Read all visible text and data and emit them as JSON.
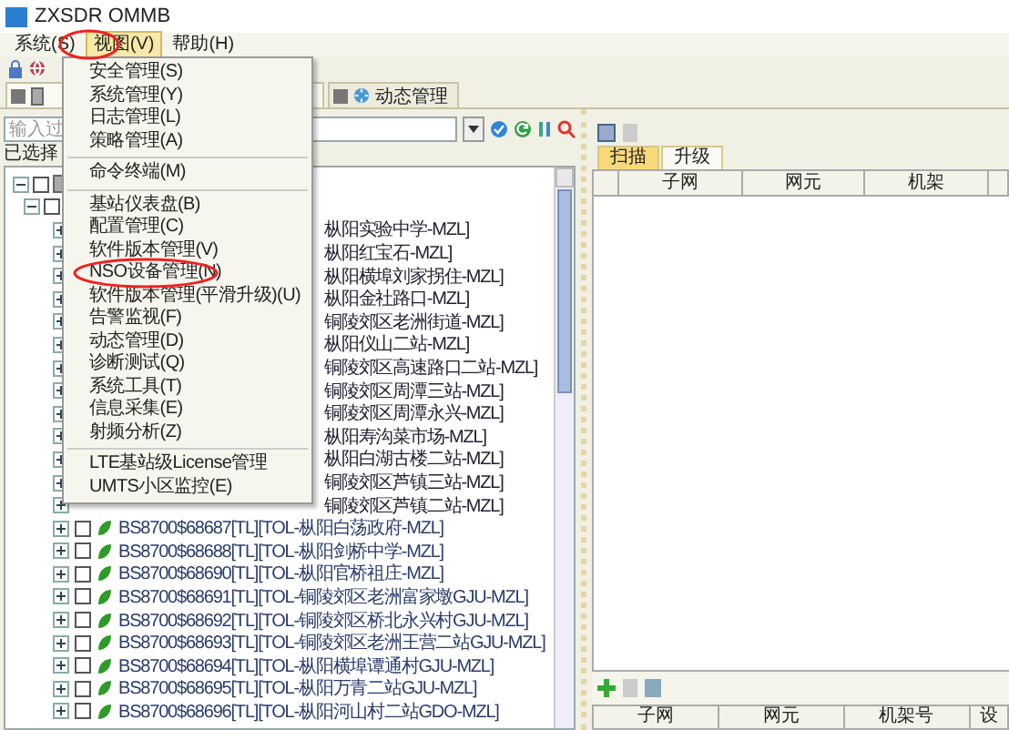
{
  "window": {
    "title": "ZXSDR OMMB"
  },
  "menubar": [
    {
      "label": "系统(S)",
      "selected": false
    },
    {
      "label": "视图(V)",
      "selected": true
    },
    {
      "label": "帮助(H)",
      "selected": false
    }
  ],
  "menu": {
    "items": [
      {
        "kind": "item",
        "label": "安全管理(S)"
      },
      {
        "kind": "item",
        "label": "系统管理(Y)"
      },
      {
        "kind": "item",
        "label": "日志管理(L)"
      },
      {
        "kind": "item",
        "label": "策略管理(A)"
      },
      {
        "kind": "separator"
      },
      {
        "kind": "item",
        "label": "命令终端(M)"
      },
      {
        "kind": "separator"
      },
      {
        "kind": "item",
        "label": "基站仪表盘(B)"
      },
      {
        "kind": "item",
        "label": "配置管理(C)"
      },
      {
        "kind": "item",
        "label": "软件版本管理(V)"
      },
      {
        "kind": "item",
        "label": "NSO设备管理(N)",
        "circled": true
      },
      {
        "kind": "item",
        "label": "软件版本管理(平滑升级)(U)"
      },
      {
        "kind": "item",
        "label": "告警监视(F)"
      },
      {
        "kind": "item",
        "label": "动态管理(D)"
      },
      {
        "kind": "item",
        "label": "诊断测试(Q)"
      },
      {
        "kind": "item",
        "label": "系统工具(T)"
      },
      {
        "kind": "item",
        "label": "信息采集(E)"
      },
      {
        "kind": "item",
        "label": "射频分析(Z)"
      },
      {
        "kind": "separator"
      },
      {
        "kind": "item",
        "label": "LTE基站级License管理"
      },
      {
        "kind": "item",
        "label": "UMTS小区监控(E)"
      }
    ]
  },
  "tabs": [
    {
      "selected": true
    },
    {
      "label": "动态管理",
      "selected": false
    }
  ],
  "left_panel": {
    "filter": {
      "placeholder": "输入过"
    },
    "selection_label": "已选择",
    "tree": [
      {
        "expanded": true,
        "checked": false,
        "children": [
          {
            "expanded": true,
            "checked": false,
            "children": [
              {
                "kind": "covered",
                "label": "枞阳实验中学-MZL]"
              },
              {
                "kind": "covered",
                "label": "枞阳红宝石-MZL]"
              },
              {
                "kind": "covered",
                "label": "枞阳横埠刘家拐住-MZL]"
              },
              {
                "kind": "covered",
                "label": "枞阳金社路口-MZL]"
              },
              {
                "kind": "covered",
                "label": "铜陵郊区老洲街道-MZL]"
              },
              {
                "kind": "covered",
                "label": "枞阳仪山二站-MZL]"
              },
              {
                "kind": "covered",
                "label": "铜陵郊区高速路口二站-MZL]"
              },
              {
                "kind": "covered",
                "label": "铜陵郊区周潭三站-MZL]"
              },
              {
                "kind": "covered",
                "label": "铜陵郊区周潭永兴-MZL]"
              },
              {
                "kind": "covered",
                "label": "枞阳寿沟菜市场-MZL]"
              },
              {
                "kind": "covered",
                "label": "枞阳白湖古楼二站-MZL]"
              },
              {
                "kind": "covered",
                "label": "铜陵郊区芦镇三站-MZL]"
              },
              {
                "kind": "covered",
                "label": "铜陵郊区芦镇二站-MZL]"
              },
              {
                "kind": "full",
                "checked": false,
                "label": "BS8700$68687[TL][TOL-枞阳白荡政府-MZL]"
              },
              {
                "kind": "full",
                "checked": false,
                "label": "BS8700$68688[TL][TOL-枞阳剑桥中学-MZL]"
              },
              {
                "kind": "full",
                "checked": false,
                "label": "BS8700$68690[TL][TOL-枞阳官桥祖庄-MZL]"
              },
              {
                "kind": "full",
                "checked": false,
                "label": "BS8700$68691[TL][TOL-铜陵郊区老洲富家墩GJU-MZL]"
              },
              {
                "kind": "full",
                "checked": false,
                "label": "BS8700$68692[TL][TOL-铜陵郊区桥北永兴村GJU-MZL]"
              },
              {
                "kind": "full",
                "checked": false,
                "label": "BS8700$68693[TL][TOL-铜陵郊区老洲王营二站GJU-MZL]"
              },
              {
                "kind": "full",
                "checked": false,
                "label": "BS8700$68694[TL][TOL-枞阳横埠谭通村GJU-MZL]"
              },
              {
                "kind": "full",
                "checked": false,
                "label": "BS8700$68695[TL][TOL-枞阳万青二站GJU-MZL]"
              },
              {
                "kind": "full",
                "checked": false,
                "label": "BS8700$68696[TL][TOL-枞阳河山村二站GDO-MZL]"
              }
            ]
          }
        ]
      }
    ]
  },
  "right_panel": {
    "tabs": [
      {
        "label": "扫描",
        "selected": true
      },
      {
        "label": "升级",
        "selected": false
      }
    ],
    "top_table": {
      "columns": [
        "子网",
        "网元",
        "机架"
      ]
    },
    "bottom_table": {
      "columns": [
        "子网",
        "网元",
        "机架号",
        "设"
      ]
    }
  }
}
